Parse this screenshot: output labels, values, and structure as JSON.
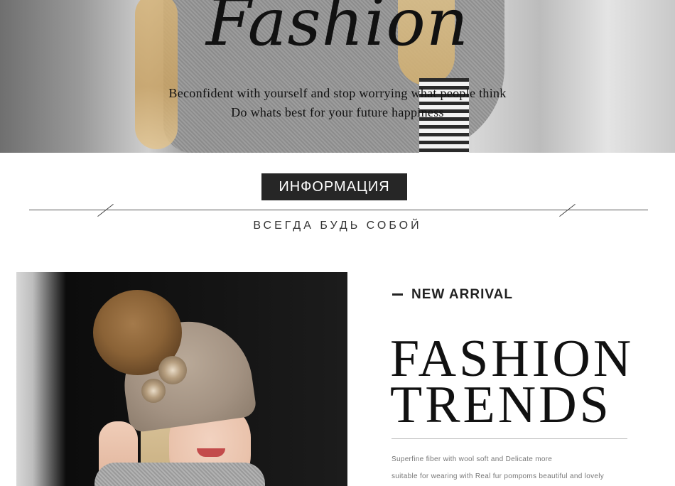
{
  "hero": {
    "script_title": "Fashion",
    "line1": "Beconfident with yourself and stop worrying what people think",
    "line2": "Do whats best for your future happiness"
  },
  "info": {
    "badge": "ИНФОРМАЦИЯ",
    "tagline": "ВСЕГДА БУДЬ СОБОЙ"
  },
  "product": {
    "new_arrival": "NEW ARRIVAL",
    "title_line1": "FASHION",
    "title_line2": "TRENDS",
    "desc_line1": "Superfine fiber with wool soft and Delicate more",
    "desc_line2": "suitable for wearing with Real fur pompoms beautiful and lovely"
  },
  "colors": {
    "badge_bg": "#262626",
    "text_dark": "#111111",
    "desc_gray": "#777777"
  }
}
